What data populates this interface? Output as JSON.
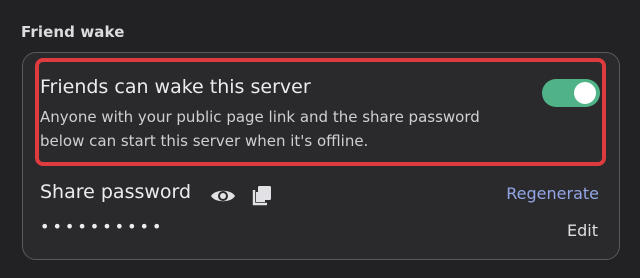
{
  "section": {
    "title": "Friend wake"
  },
  "toggle": {
    "title": "Friends can wake this server",
    "description": "Anyone with your public page link and the share password below can start this server when it's offline.",
    "state": "on",
    "on_color": "#4fb387"
  },
  "highlight": {
    "color": "#dd3b3d"
  },
  "share_password": {
    "label": "Share password",
    "value_masked": "••••••••••",
    "show_icon": "eye-icon",
    "copy_icon": "copy-icon",
    "regenerate_label": "Regenerate",
    "regenerate_color": "#93a7e6",
    "edit_label": "Edit"
  }
}
